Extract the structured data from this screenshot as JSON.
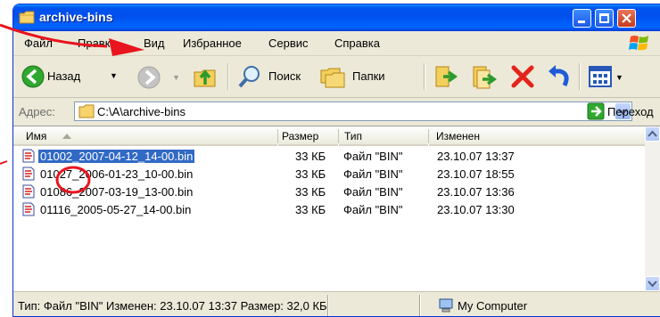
{
  "window": {
    "title": "archive-bins"
  },
  "menu": [
    "Файл",
    "Правка",
    "Вид",
    "Избранное",
    "Сервис",
    "Справка"
  ],
  "toolbar": {
    "back_label": "Назад",
    "search_label": "Поиск",
    "folders_label": "Папки"
  },
  "address": {
    "label": "Адрес:",
    "path": "C:\\A\\archive-bins",
    "go_label": "Переход"
  },
  "columns": {
    "name": "Имя",
    "size": "Размер",
    "type": "Тип",
    "modified": "Изменен"
  },
  "files": [
    {
      "name": "01002_2007-04-12_14-00.bin",
      "size": "33 КБ",
      "type": "Файл \"BIN\"",
      "modified": "23.10.07 13:37",
      "selected": true
    },
    {
      "name": "01027_2006-01-23_10-00.bin",
      "size": "33 КБ",
      "type": "Файл \"BIN\"",
      "modified": "23.10.07 18:55",
      "selected": false
    },
    {
      "name": "01086_2007-03-19_13-00.bin",
      "size": "33 КБ",
      "type": "Файл \"BIN\"",
      "modified": "23.10.07 13:36",
      "selected": false
    },
    {
      "name": "01116_2005-05-27_14-00.bin",
      "size": "33 КБ",
      "type": "Файл \"BIN\"",
      "modified": "23.10.07 13:30",
      "selected": false
    }
  ],
  "status": {
    "details": "Тип: Файл \"BIN\" Изменен: 23.10.07 13:37 Размер: 32,0 КБ",
    "location": "My Computer"
  },
  "colors": {
    "titlebar": "#0053ee",
    "selection": "#316ac5",
    "annotation": "#e8141e"
  }
}
